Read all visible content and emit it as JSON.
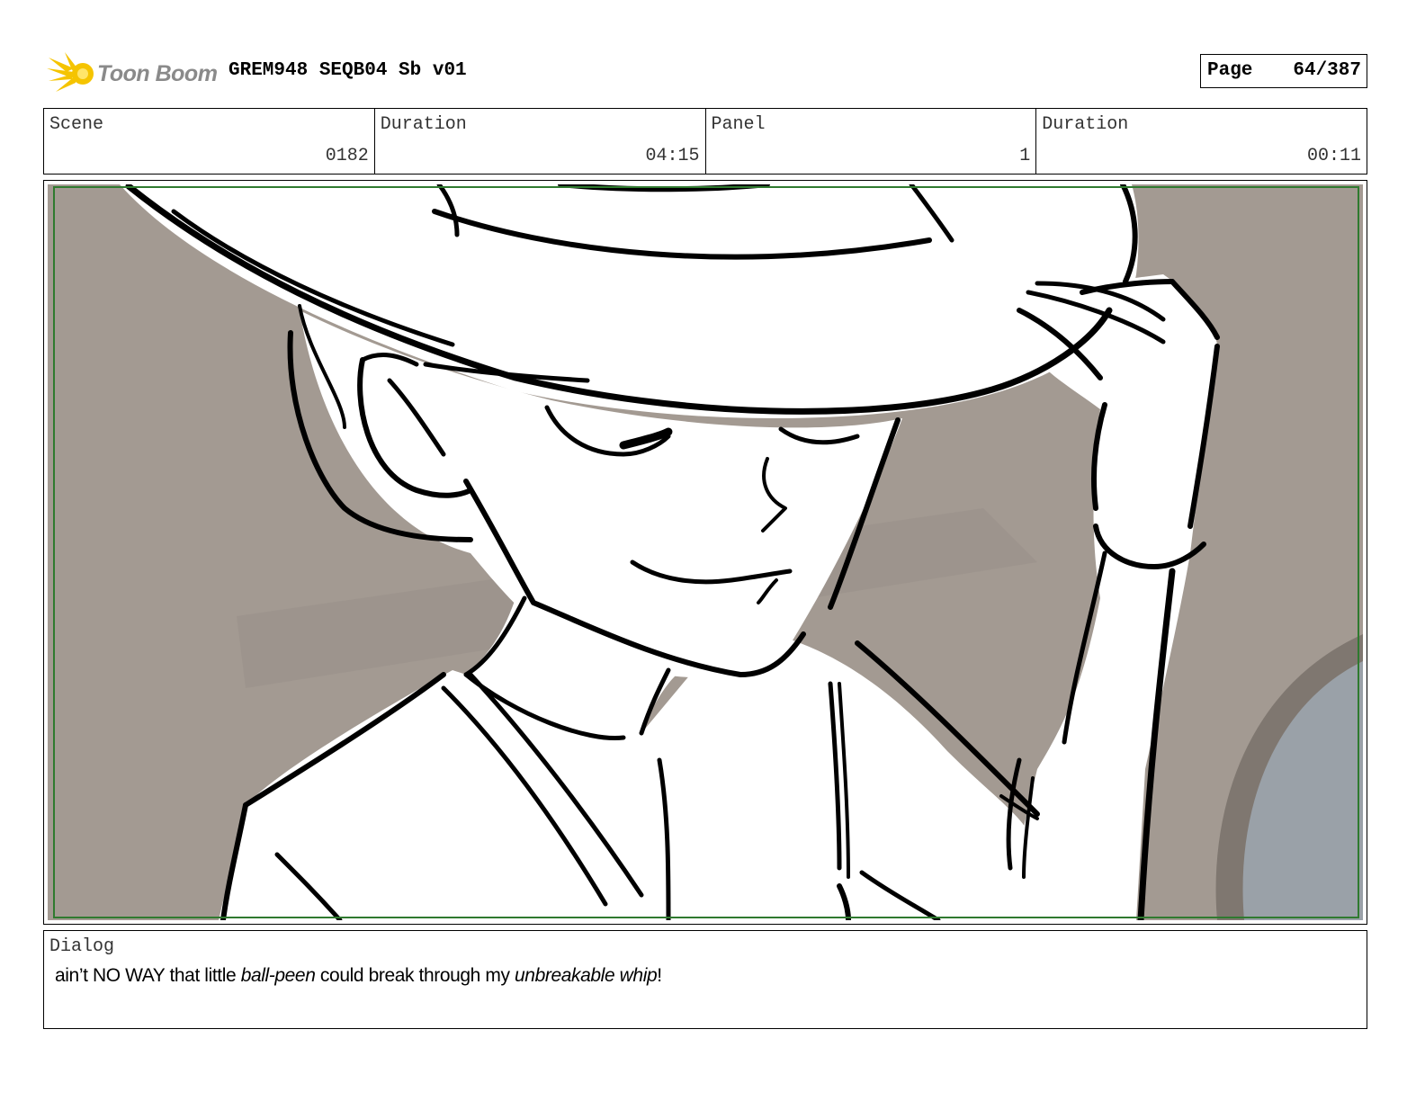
{
  "header": {
    "logo_text": "Toon Boom",
    "doc_title": "GREM948 SEQB04 Sb v01",
    "page_label": "Page",
    "page_value": "64/387"
  },
  "info": {
    "scene_label": "Scene",
    "scene_value": "0182",
    "scene_duration_label": "Duration",
    "scene_duration_value": "04:15",
    "panel_label": "Panel",
    "panel_value": "1",
    "panel_duration_label": "Duration",
    "panel_duration_value": "00:11"
  },
  "dialog": {
    "label": "Dialog",
    "parts": {
      "p1": "ain’t NO WAY that little ",
      "p2": "ball-peen",
      "p3": " could break through my ",
      "p4": "unbreakable whip",
      "p5": "!"
    }
  },
  "colors": {
    "background_gray": "#a39a92",
    "window_blue": "#9aa1a8",
    "safe_frame_green": "#2f7a2f",
    "logo_yellow": "#f5c400",
    "logo_text_gray": "#8a8a8a"
  },
  "icons": {
    "logo": "toon-boom-star-icon"
  }
}
